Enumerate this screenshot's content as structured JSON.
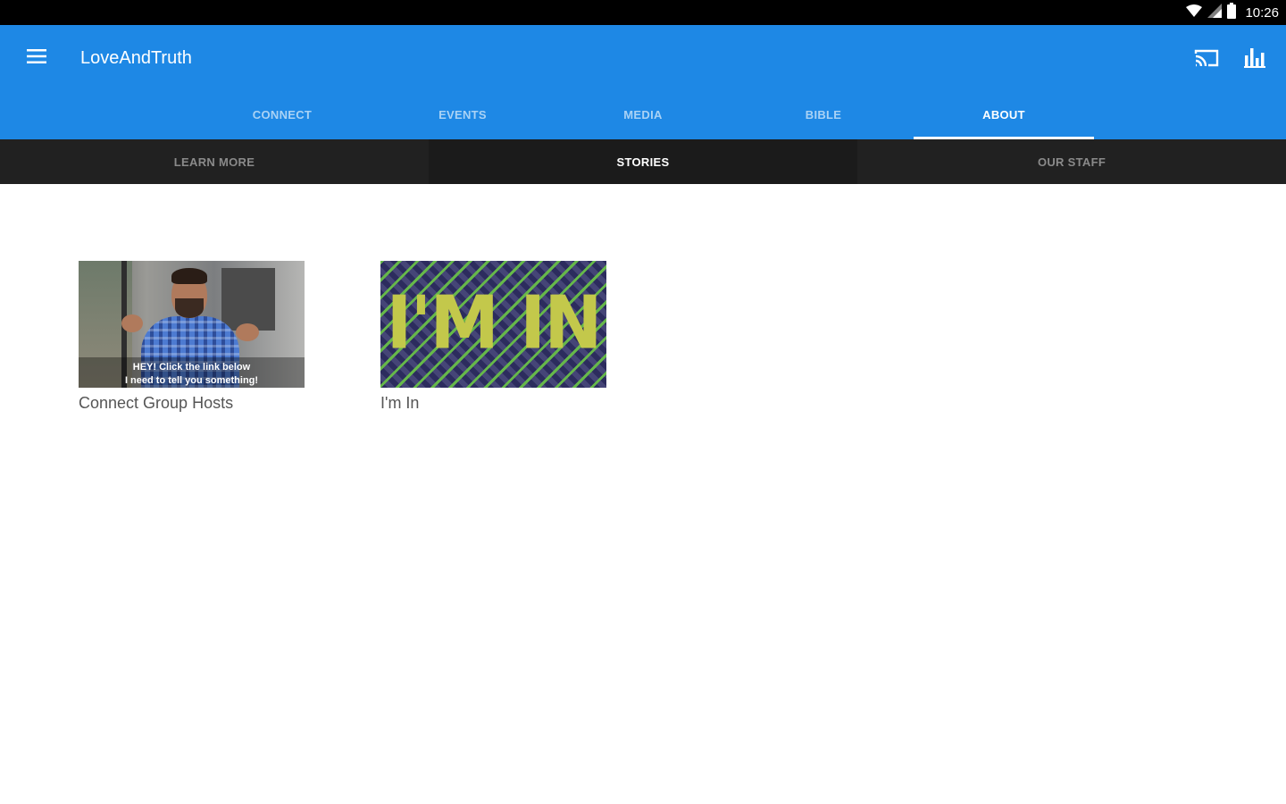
{
  "status_bar": {
    "time": "10:26",
    "icons": [
      "wifi-icon",
      "cell-signal-icon",
      "battery-icon"
    ]
  },
  "app_bar": {
    "title": "LoveAndTruth",
    "icons": [
      "menu-icon",
      "cast-icon",
      "bar-chart-icon"
    ],
    "color": "#1e88e5"
  },
  "main_tabs": [
    {
      "label": "CONNECT",
      "active": false
    },
    {
      "label": "EVENTS",
      "active": false
    },
    {
      "label": "MEDIA",
      "active": false
    },
    {
      "label": "BIBLE",
      "active": false
    },
    {
      "label": "ABOUT",
      "active": true
    }
  ],
  "sub_tabs": [
    {
      "label": "LEARN MORE",
      "active": false
    },
    {
      "label": "STORIES",
      "active": true
    },
    {
      "label": "OUR STAFF",
      "active": false
    }
  ],
  "stories": [
    {
      "title": "Connect Group Hosts",
      "thumbnail_caption": [
        "HEY! Click the link below",
        "I need to tell you something!"
      ]
    },
    {
      "title": "I'm In",
      "thumbnail_text": "I'M IN"
    }
  ]
}
